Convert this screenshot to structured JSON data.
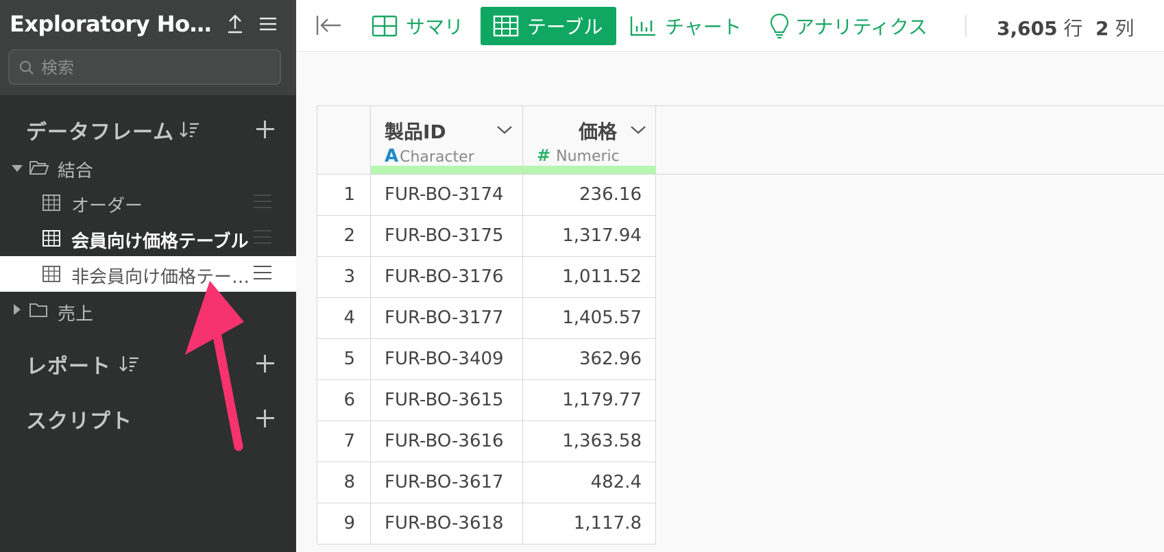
{
  "sidebar": {
    "title": "Exploratory Hour Analysis",
    "search": {
      "placeholder": "検索",
      "value": ""
    },
    "sections": {
      "dataframes": "データフレーム",
      "reports": "レポート",
      "scripts": "スクリプト"
    },
    "tree": {
      "folder_open": "結合",
      "items": [
        "オーダー",
        "会員向け価格テーブル",
        "非会員向け価格テー…"
      ],
      "folder_closed": "売上"
    }
  },
  "toolbar": {
    "tabs": [
      {
        "label": "サマリ",
        "icon": "summary-grid-icon"
      },
      {
        "label": "テーブル",
        "icon": "table-icon",
        "active": true
      },
      {
        "label": "チャート",
        "icon": "bar-chart-icon"
      },
      {
        "label": "アナリティクス",
        "icon": "lightbulb-icon"
      }
    ],
    "rows_count": "3,605",
    "rows_unit": "行",
    "cols_count": "2",
    "cols_unit": "列"
  },
  "table": {
    "columns": [
      {
        "name": "製品ID",
        "type_glyph": "A",
        "type": "Character"
      },
      {
        "name": "価格",
        "type_glyph": "#",
        "type": "Numeric"
      }
    ],
    "rows": [
      {
        "idx": "1",
        "id": "FUR-BO-3174",
        "price": "236.16"
      },
      {
        "idx": "2",
        "id": "FUR-BO-3175",
        "price": "1,317.94"
      },
      {
        "idx": "3",
        "id": "FUR-BO-3176",
        "price": "1,011.52"
      },
      {
        "idx": "4",
        "id": "FUR-BO-3177",
        "price": "1,405.57"
      },
      {
        "idx": "5",
        "id": "FUR-BO-3409",
        "price": "362.96"
      },
      {
        "idx": "6",
        "id": "FUR-BO-3615",
        "price": "1,179.77"
      },
      {
        "idx": "7",
        "id": "FUR-BO-3616",
        "price": "1,363.58"
      },
      {
        "idx": "8",
        "id": "FUR-BO-3617",
        "price": "482.4"
      },
      {
        "idx": "9",
        "id": "FUR-BO-3618",
        "price": "1,117.8"
      }
    ]
  },
  "colors": {
    "accent": "#10a762",
    "sidebar_bg": "#2e2f2f",
    "arrow": "#f7336f",
    "type_bar": "#b8f5b0"
  }
}
